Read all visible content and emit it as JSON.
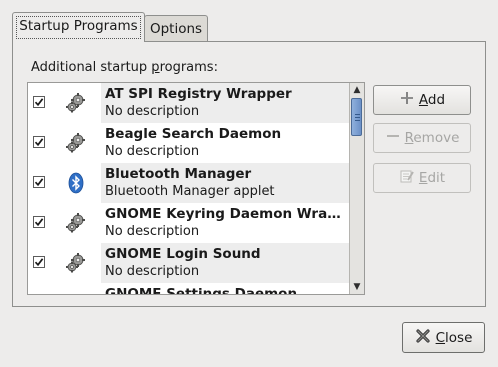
{
  "tabs": [
    {
      "label": "Startup Programs",
      "active": true
    },
    {
      "label": "Options",
      "active": false
    }
  ],
  "list_caption": {
    "before": "Additional startup ",
    "mnemonic": "p",
    "after": "rograms:"
  },
  "programs": [
    {
      "checked": true,
      "icon": "gears-icon",
      "title": "AT SPI Registry Wrapper",
      "description": "No description"
    },
    {
      "checked": true,
      "icon": "gears-icon",
      "title": "Beagle Search Daemon",
      "description": "No description"
    },
    {
      "checked": true,
      "icon": "bluetooth-icon",
      "title": "Bluetooth Manager",
      "description": "Bluetooth Manager applet"
    },
    {
      "checked": true,
      "icon": "gears-icon",
      "title": "GNOME Keyring Daemon Wrapper",
      "description": "No description"
    },
    {
      "checked": true,
      "icon": "gears-icon",
      "title": "GNOME Login Sound",
      "description": "No description"
    },
    {
      "checked": true,
      "icon": "gears-icon",
      "title": "GNOME Settings Daemon",
      "description": ""
    }
  ],
  "buttons": {
    "add": {
      "mnemonic": "A",
      "rest": "dd",
      "enabled": true,
      "icon": "plus-icon"
    },
    "remove": {
      "mnemonic": "R",
      "rest": "emove",
      "enabled": false,
      "icon": "minus-icon"
    },
    "edit": {
      "mnemonic": "E",
      "rest": "dit",
      "enabled": false,
      "icon": "edit-icon"
    },
    "close": {
      "mnemonic": "C",
      "rest": "lose",
      "enabled": true,
      "icon": "close-icon"
    }
  },
  "colors": {
    "window_bg": "#edeceb",
    "scroll_thumb": "#7a9ccf",
    "bluetooth": "#2f6fc6"
  }
}
